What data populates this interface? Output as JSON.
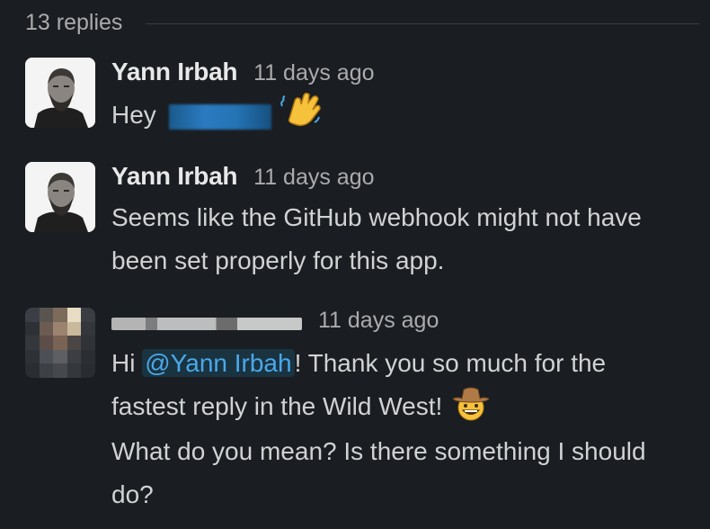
{
  "thread": {
    "replies_label": "13 replies"
  },
  "messages": [
    {
      "author": "Yann Irbah",
      "timestamp": "11 days ago",
      "text": "Hey",
      "emoji": "waving-hand-emoji"
    },
    {
      "author": "Yann Irbah",
      "timestamp": "11 days ago",
      "text": "Seems like the GitHub webhook might not have been set properly for this app."
    },
    {
      "timestamp": "11 days ago",
      "text_prefix": "Hi ",
      "mention": "@Yann Irbah",
      "text_line1_rest": "! Thank you so much for the fastest reply in the Wild West!",
      "emoji": "cowboy-face-emoji",
      "text_line2": "What do you mean? Is there something I should do?"
    }
  ],
  "colors": {
    "background": "#1a1d21",
    "text": "#d1d2d3",
    "muted": "#ababad",
    "mention": "#4aa8e8"
  }
}
